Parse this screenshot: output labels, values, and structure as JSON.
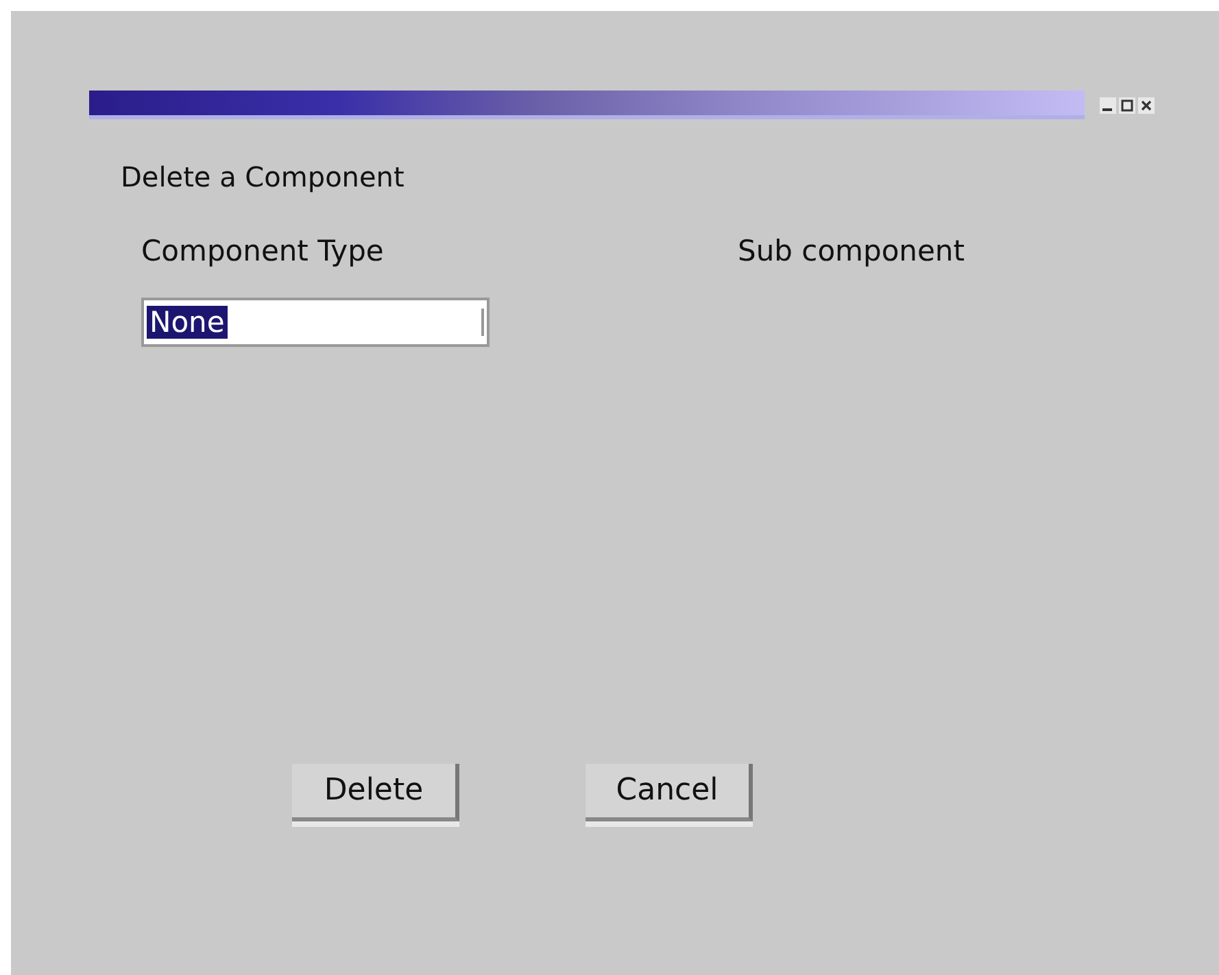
{
  "heading": "Delete a Component",
  "labels": [
    "Component Type",
    "Sub component"
  ],
  "dropdown": {
    "value": "None",
    "highlighted": true
  },
  "buttons": [
    "Delete",
    "Cancel"
  ]
}
